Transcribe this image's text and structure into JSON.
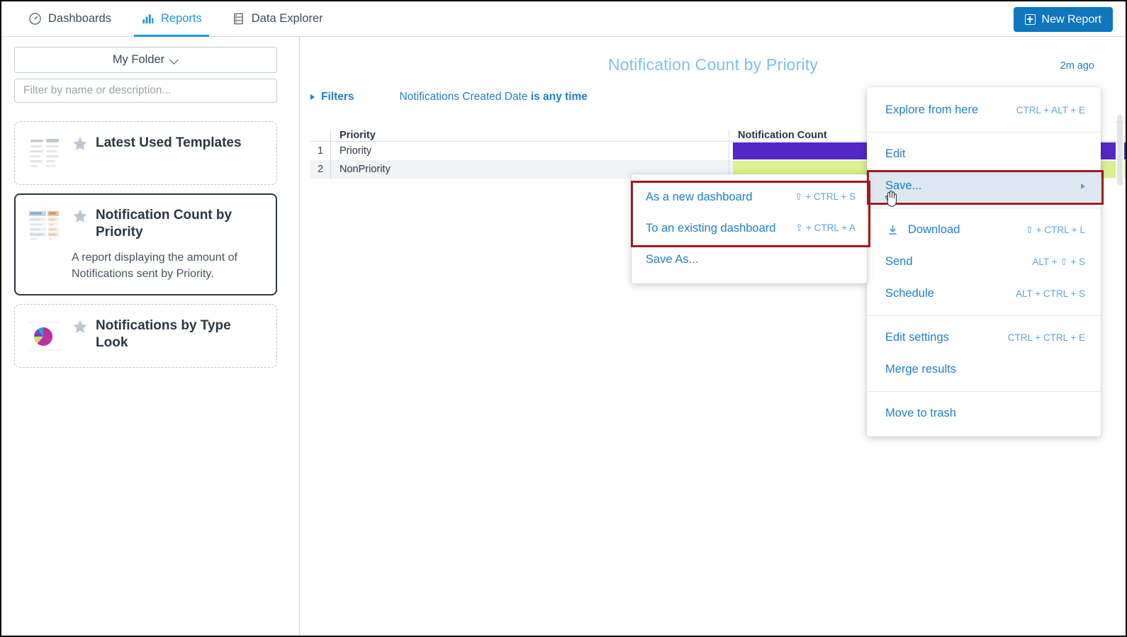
{
  "topnav": {
    "tabs": [
      {
        "label": "Dashboards",
        "icon": "gauge-icon",
        "active": false
      },
      {
        "label": "Reports",
        "icon": "bar-chart-icon",
        "active": true
      },
      {
        "label": "Data Explorer",
        "icon": "database-icon",
        "active": false
      }
    ],
    "new_report_label": "New Report",
    "accent_color": "#0e76bc",
    "active_tab_color": "#2196d6"
  },
  "sidebar": {
    "folder_label": "My Folder",
    "filter_placeholder": "Filter by name or description...",
    "filter_value": "",
    "cards": [
      {
        "title": "Latest Used Templates",
        "description": "",
        "thumb": "table-thumb-plain",
        "selected": false,
        "starred": false
      },
      {
        "title": "Notification Count by Priority",
        "description": "A report displaying the amount of Notifications sent by Priority.",
        "thumb": "table-thumb-colored",
        "selected": true,
        "starred": false
      },
      {
        "title": "Notifications by Type Look",
        "description": "",
        "thumb": "pie-chart-thumb",
        "selected": false,
        "starred": false
      }
    ]
  },
  "report": {
    "title": "Notification Count by Priority",
    "title_color": "#7ec2ea",
    "updated": "2m ago",
    "filters_label": "Filters",
    "filter_field": "Notifications Created Date ",
    "filter_condition": "is any time"
  },
  "table": {
    "columns": [
      "Priority",
      "Notification Count"
    ],
    "rows": [
      {
        "index": "1",
        "priority": "Priority",
        "bar_color": "#5328c4",
        "bar_width_pct": 100
      },
      {
        "index": "2",
        "priority": "NonPriority",
        "bar_color": "#dbf08f",
        "bar_width_pct": 100
      }
    ]
  },
  "main_menu": {
    "items": [
      {
        "label": "Explore from here",
        "keys": "CTRL + ALT + E",
        "icon": "",
        "highlight": false,
        "submenu": false,
        "sep_after": true
      },
      {
        "label": "Edit",
        "keys": "",
        "icon": "",
        "highlight": false,
        "submenu": false,
        "sep_after": false
      },
      {
        "label": "Save...",
        "keys": "",
        "icon": "",
        "highlight": true,
        "submenu": true,
        "sep_after": true
      },
      {
        "label": "Download",
        "keys": "⇧ + CTRL + L",
        "icon": "download-icon",
        "highlight": false,
        "submenu": false,
        "sep_after": false
      },
      {
        "label": "Send",
        "keys": "ALT + ⇧ + S",
        "icon": "",
        "highlight": false,
        "submenu": false,
        "sep_after": false
      },
      {
        "label": "Schedule",
        "keys": "ALT + CTRL + S",
        "icon": "",
        "highlight": false,
        "submenu": false,
        "sep_after": true
      },
      {
        "label": "Edit settings",
        "keys": "CTRL + CTRL + E",
        "icon": "",
        "highlight": false,
        "submenu": false,
        "sep_after": false
      },
      {
        "label": "Merge results",
        "keys": "",
        "icon": "",
        "highlight": false,
        "submenu": false,
        "sep_after": true
      },
      {
        "label": "Move to trash",
        "keys": "",
        "icon": "",
        "highlight": false,
        "submenu": false,
        "sep_after": false
      }
    ]
  },
  "save_submenu": {
    "items": [
      {
        "label": "As a new dashboard",
        "keys": "⇧ + CTRL + S"
      },
      {
        "label": "To an existing dashboard",
        "keys": "⇧ + CTRL + A"
      },
      {
        "label": "Save As...",
        "keys": ""
      }
    ]
  },
  "annotations": {
    "highlight_color": "#9e1b22"
  }
}
